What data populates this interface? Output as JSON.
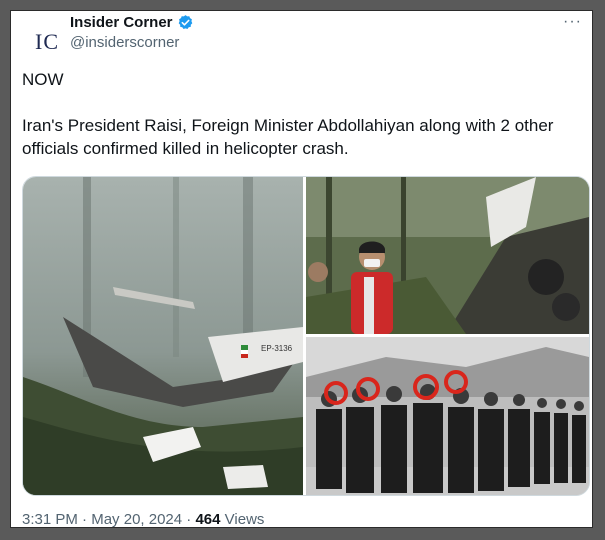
{
  "account": {
    "avatar_text": "IC",
    "display_name": "Insider Corner",
    "handle": "@insiderscorner",
    "verified_icon": "verified-badge-icon",
    "verified_color": "#1d9bf0"
  },
  "menu": {
    "more_label": "···"
  },
  "tweet": {
    "line1": "NOW",
    "line2": "Iran's President Raisi, Foreign Minister Abdollahiyan along with 2 other officials confirmed killed in helicopter crash."
  },
  "media": {
    "images": [
      {
        "name": "helicopter-wreck-photo"
      },
      {
        "name": "rescue-worker-photo"
      },
      {
        "name": "officials-group-photo"
      }
    ],
    "tail_number_text": "EP-3136"
  },
  "footer": {
    "time": "3:31 PM",
    "separator": "·",
    "date": "May 20, 2024",
    "views_count": "464",
    "views_label": "Views"
  },
  "colors": {
    "text_primary": "#0f1419",
    "text_secondary": "#536471",
    "border": "#cfd9de",
    "highlight_circle": "#d9261c"
  }
}
